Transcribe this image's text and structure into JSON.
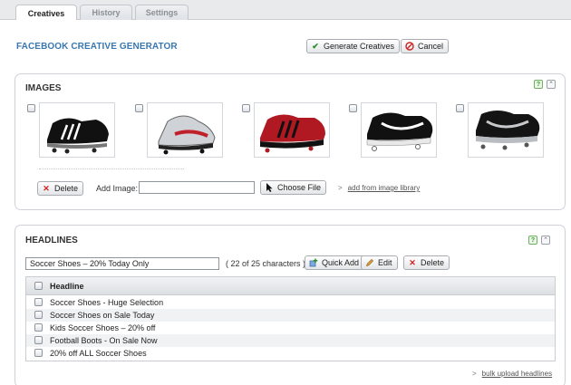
{
  "tabs": [
    {
      "label": "Creatives",
      "active": true
    },
    {
      "label": "History",
      "active": false
    },
    {
      "label": "Settings",
      "active": false
    }
  ],
  "header": {
    "title": "FACEBOOK CREATIVE GENERATOR",
    "generate_label": "Generate Creatives",
    "cancel_label": "Cancel"
  },
  "images": {
    "title": "IMAGES",
    "help_icon": "help-icon",
    "collapse_icon": "collapse-icon",
    "delete_label": "Delete",
    "add_image_label": "Add Image:",
    "file_value": "",
    "choose_file_label": "Choose File",
    "library_arrow": ">",
    "library_link": "add from image library",
    "thumbnails": [
      {
        "name": "adidas-black-boot",
        "checked": false
      },
      {
        "name": "nike-silver-red-boot",
        "checked": false
      },
      {
        "name": "adidas-red-black-boot",
        "checked": false
      },
      {
        "name": "puma-black-white-boot",
        "checked": false
      },
      {
        "name": "puma-black-silver-boot",
        "checked": false
      }
    ]
  },
  "headlines": {
    "title": "HEADLINES",
    "input_value": "Soccer Shoes – 20% Today Only",
    "char_count": "( 22 of 25 characters )",
    "quick_add_label": "Quick Add",
    "edit_label": "Edit",
    "delete_label": "Delete",
    "column_header": "Headline",
    "rows": [
      "Soccer Shoes - Huge Selection",
      "Soccer Shoes on Sale Today",
      "Kids Soccer Shoes – 20% off",
      "Football Boots - On Sale Now",
      "20% off ALL Soccer Shoes"
    ],
    "bulk_arrow": ">",
    "bulk_link": "bulk upload headlines"
  },
  "colors": {
    "title_blue": "#3a77b0",
    "help_green": "#3a9a2e",
    "delete_red": "#cc2222",
    "check_green": "#2e8b2e"
  }
}
